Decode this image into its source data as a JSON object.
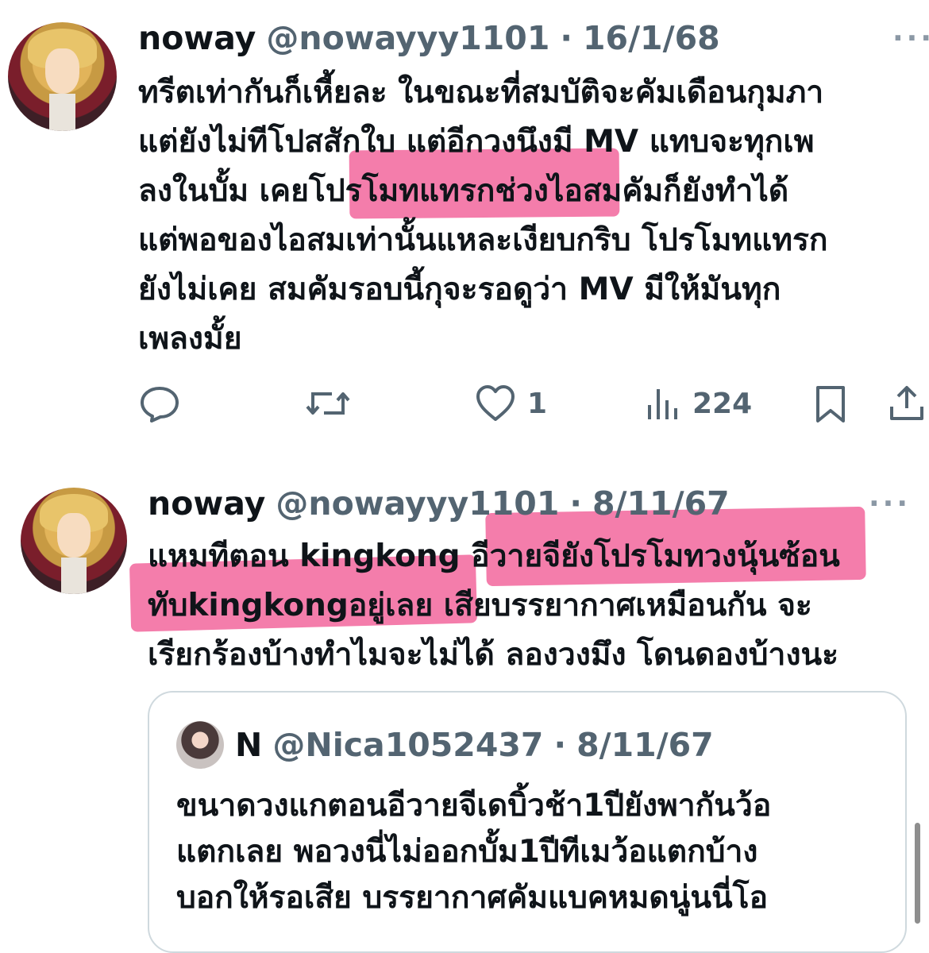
{
  "tweet1": {
    "name": "noway",
    "handle": "@nowayyy1101",
    "separator": "·",
    "date": "16/1/68",
    "more": "···",
    "lines": [
      "ทรีตเท่ากันก็เหี้ยละ ในขณะที่สมบัติจะคัมเดือนกุมภา",
      "แต่ยังไม่ทีโปสสักใบ แต่อีกวงนึงมี MV แทบจะทุกเพ",
      "ลงในบั้ม เคยโปรโมทแทรกช่วงไอสมคัมก็ยังทำได้",
      "แต่พอของไอสมเท่านั้นแหละเงียบกริบ โปรโมทแทรก",
      "ยังไม่เคย สมคัมรอบนี้กุจะรอดูว่า MV มีให้มันทุก",
      "เพลงมั้ย"
    ],
    "actions": {
      "like_count": "1",
      "views_count": "224"
    }
  },
  "tweet2": {
    "name": "noway",
    "handle": "@nowayyy1101",
    "separator": "·",
    "date": "8/11/67",
    "more": "···",
    "lines": [
      "แหมทีตอน kingkong อีวายจียังโปรโมทวงนุ้นซ้อน",
      "ทับkingkongอยู่เลย เสียบรรยากาศเหมือนกัน จะ",
      "เรียกร้องบ้างทำไมจะไม่ได้ ลองวงมึง โดนดองบ้างนะ"
    ]
  },
  "quote": {
    "name": "N",
    "handle": "@Nica1052437",
    "separator": "·",
    "date": "8/11/67",
    "lines": [
      "ขนาดวงแกตอนอีวายจีเดบิ้วช้า1ปียังพากันว้อ",
      "แตกเลย พอวงนี่ไม่ออกบั้ม1ปีทีเมว้อแตกบ้าง",
      "บอกให้รอเสีย บรรยากาศคัมแบคหมดนู่นนี่โอ"
    ]
  },
  "colors": {
    "text": "#0f1419",
    "secondary": "#536471",
    "highlight": "#f0518f",
    "border": "#cfd9de"
  },
  "icons": [
    "reply-icon",
    "retweet-icon",
    "heart-icon",
    "views-icon",
    "bookmark-icon",
    "share-icon",
    "more-icon"
  ]
}
